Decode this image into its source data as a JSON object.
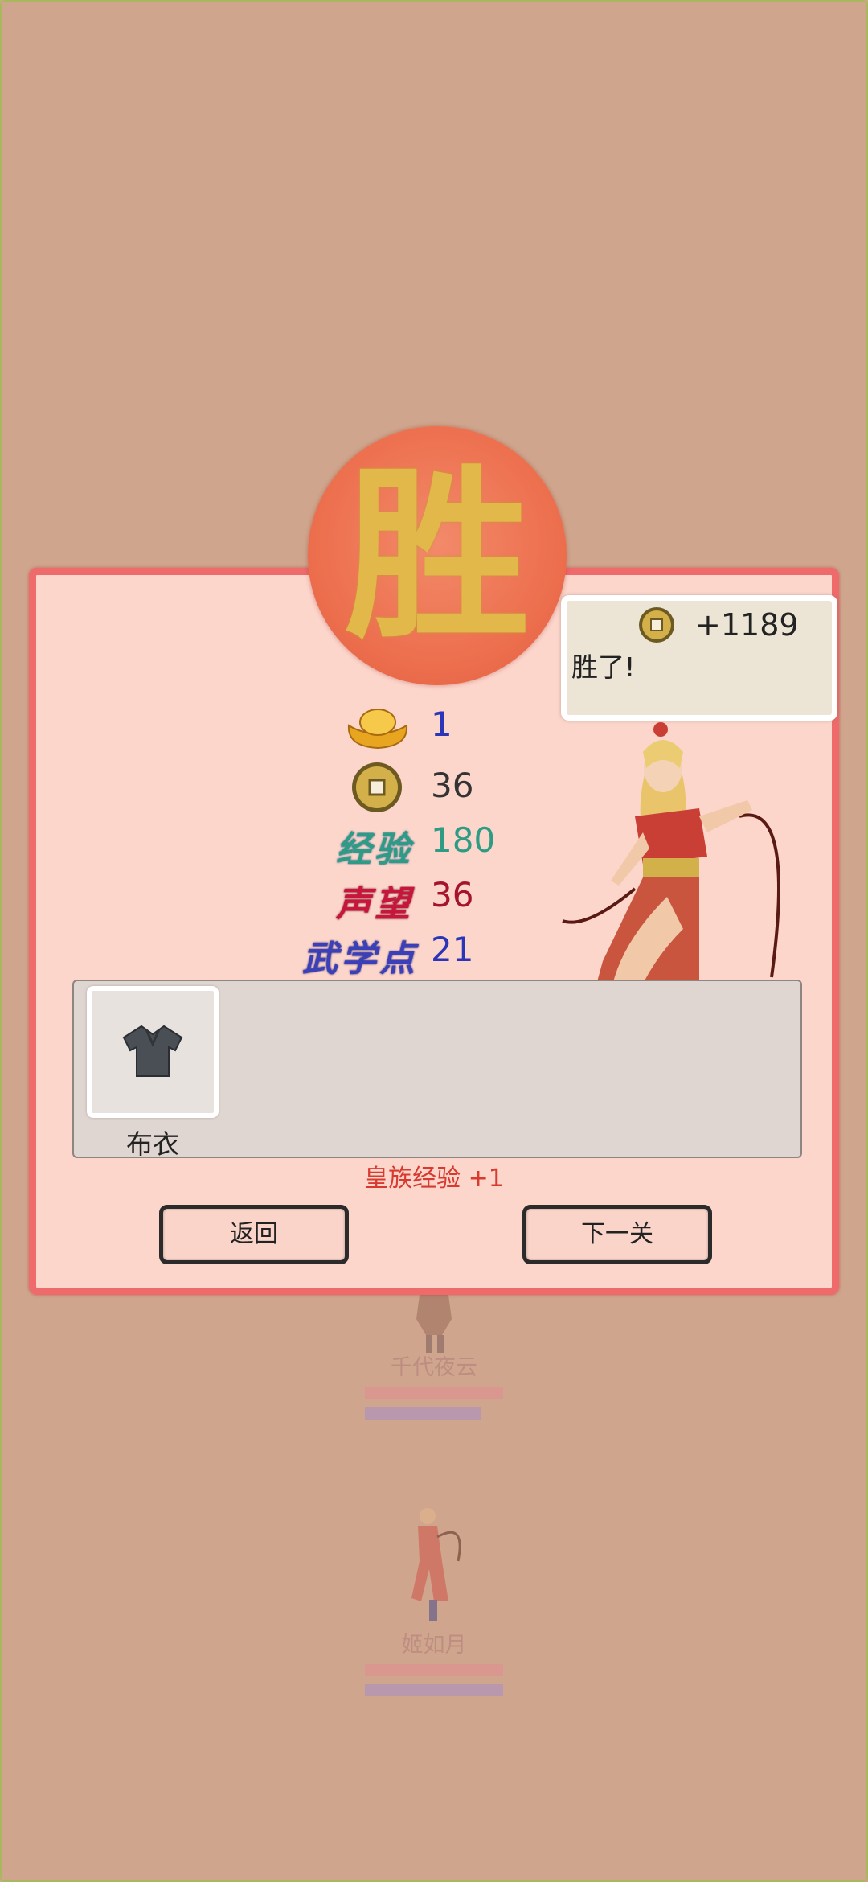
{
  "result": {
    "seal_text": "胜",
    "speech": {
      "gold_gain": "+1189",
      "message": "胜了!"
    },
    "rewards": [
      {
        "icon": "gold-ingot-icon",
        "label": "",
        "value": "1",
        "color": "#2b35b8"
      },
      {
        "icon": "copper-coin-icon",
        "label": "",
        "value": "36",
        "color": "#333333"
      },
      {
        "icon": "",
        "label": "经验",
        "value": "180",
        "color": "#2e9c84",
        "label_color": "#2e9c84"
      },
      {
        "icon": "",
        "label": "声望",
        "value": "36",
        "color": "#a5142c",
        "label_color": "#c8153c"
      },
      {
        "icon": "",
        "label": "武学点",
        "value": "21",
        "color": "#2b35b8",
        "label_color": "#3b3fb8"
      }
    ],
    "items": [
      {
        "name": "布衣",
        "icon": "shirt-icon"
      }
    ],
    "royal_exp": "皇族经验 +1",
    "buttons": {
      "back": "返回",
      "next": "下一关"
    }
  },
  "background_units": [
    {
      "name": "千代夜云"
    },
    {
      "name": "姬如月"
    }
  ],
  "colors": {
    "background": "#cfa68d",
    "panel_bg": "#fcd5cb",
    "panel_border": "#ef6a6a",
    "seal": "#ed704f",
    "seal_text": "#e2b84a",
    "royal_exp": "#d83a30"
  }
}
